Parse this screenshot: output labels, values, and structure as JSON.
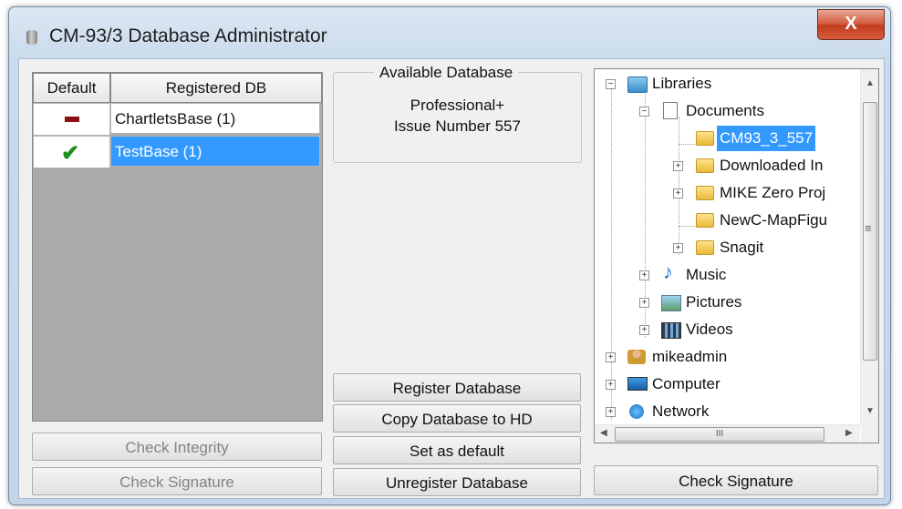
{
  "window": {
    "title": "CM-93/3 Database Administrator",
    "close_glyph": "X"
  },
  "grid": {
    "headers": {
      "default": "Default",
      "registered": "Registered DB"
    },
    "rows": [
      {
        "name": "ChartletsBase (1)",
        "status": "dash",
        "selected": false
      },
      {
        "name": "TestBase (1)",
        "status": "check",
        "selected": true
      }
    ],
    "check_glyph": "✔"
  },
  "left_buttons": {
    "check_integrity": "Check Integrity",
    "check_signature": "Check Signature"
  },
  "available": {
    "title": "Available Database",
    "line1": "Professional+",
    "line2": "Issue Number 557"
  },
  "middle_buttons": {
    "register": "Register Database",
    "copy": "Copy Database to HD",
    "set_default": "Set as default",
    "unregister": "Unregister Database"
  },
  "tree": {
    "libraries": "Libraries",
    "documents": "Documents",
    "cm93": "CM93_3_557",
    "downloaded": "Downloaded In",
    "mike": "MIKE Zero Proj",
    "newcmap": "NewC-MapFigu",
    "snagit": "Snagit",
    "music": "Music",
    "music_glyph": "♪",
    "pictures": "Pictures",
    "videos": "Videos",
    "mikeadmin": "mikeadmin",
    "computer": "Computer",
    "network": "Network",
    "plus": "+",
    "minus": "−",
    "scroll_up": "▲",
    "scroll_down": "▼",
    "scroll_left": "◀",
    "scroll_right": "▶",
    "thumb_grip": "III",
    "vthumb_grip": "≡"
  },
  "right_buttons": {
    "check_signature": "Check Signature"
  }
}
